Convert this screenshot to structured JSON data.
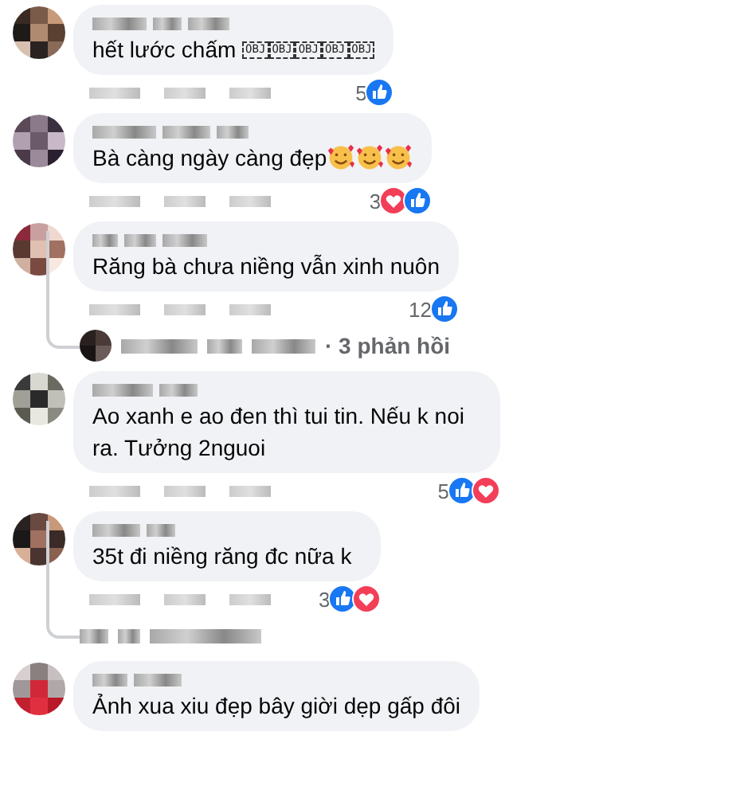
{
  "comments": [
    {
      "text": "hết lước chấm ",
      "trailing_icons": [
        {
          "kind": "object-placeholder",
          "label": "OBJ"
        },
        {
          "kind": "object-placeholder",
          "label": "OBJ"
        },
        {
          "kind": "object-placeholder",
          "label": "OBJ"
        },
        {
          "kind": "object-placeholder",
          "label": "OBJ"
        },
        {
          "kind": "object-placeholder",
          "label": "OBJ"
        }
      ],
      "reactions": [
        {
          "kind": "like"
        }
      ],
      "reaction_count": "5"
    },
    {
      "text": "Bà càng ngày càng đẹp",
      "trailing_icons": [
        {
          "kind": "smiling-hearts"
        },
        {
          "kind": "smiling-hearts"
        },
        {
          "kind": "smiling-hearts"
        }
      ],
      "reactions": [
        {
          "kind": "love"
        },
        {
          "kind": "like"
        }
      ],
      "reaction_count": "3"
    },
    {
      "text": "Răng bà chưa niềng vẫn xinh nuôn",
      "reactions": [
        {
          "kind": "like"
        }
      ],
      "reaction_count": "12",
      "reply_preview": {
        "kind": "replies",
        "text": "· 3 phản hồi"
      }
    },
    {
      "text": "Ao xanh e ao đen thì tui tin. Nếu k noi ra. Tưởng 2nguoi",
      "reactions": [
        {
          "kind": "like"
        },
        {
          "kind": "love"
        }
      ],
      "reaction_count": "5"
    },
    {
      "text": "35t đi niềng răng đc nữa k",
      "reactions": [
        {
          "kind": "like"
        },
        {
          "kind": "love"
        }
      ],
      "reaction_count": "3",
      "reply_preview": {
        "kind": "blurred"
      }
    },
    {
      "text": "Ảnh xua xiu đẹp bây giời dẹp gấp đôi"
    }
  ]
}
